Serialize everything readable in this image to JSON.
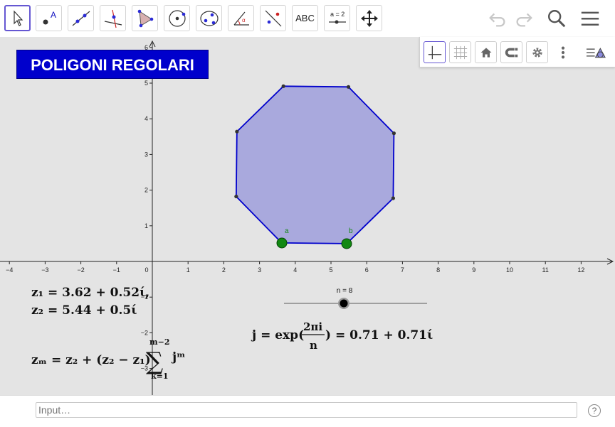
{
  "toolbar": {
    "tools": [
      "move",
      "point",
      "line",
      "perpendicular-line",
      "polygon",
      "circle-with-center",
      "ellipse",
      "angle",
      "reflect",
      "text",
      "slider",
      "move-graphics-view"
    ],
    "text_tool_label": "ABC",
    "slider_tool_label": "a = 2",
    "actions": [
      "undo",
      "redo",
      "search",
      "menu"
    ]
  },
  "style_bar": {
    "buttons": [
      "axes-toggle",
      "grid-toggle",
      "standard-view",
      "point-capturing",
      "graphics-settings",
      "more-options",
      "toggle-style-bar"
    ]
  },
  "title": "POLIGONI  REGOLARI",
  "graph": {
    "x_ticks": [
      "−4",
      "−3",
      "−2",
      "−1",
      "0",
      "1",
      "2",
      "3",
      "4",
      "5",
      "6",
      "7",
      "8",
      "9",
      "10",
      "11",
      "12"
    ],
    "y_ticks": [
      "6",
      "5",
      "4",
      "3",
      "2",
      "1",
      "−1",
      "−2",
      "−3"
    ],
    "polygon_color": "#a9a9dd",
    "polygon_edge_color": "#0000cc",
    "point_a_label": "a",
    "point_b_label": "b",
    "slider_label": "n = 8",
    "slider_value": 8
  },
  "formulas": {
    "z1": "z₁ = 3.62 + 0.52ί,",
    "z2": "z₂ = 5.44 + 0.5ί",
    "j_lhs": "j = exp(",
    "j_num": "2πi",
    "j_den": "n",
    "j_rhs": ") = 0.71 + 0.71ί",
    "zm_lhs": "zₘ = z₂ + (z₂ − z₁)",
    "sum_upper": "m−2",
    "sum_lower": "k=1",
    "sum_symbol": "∑",
    "sum_term": "jᵐ"
  },
  "input_bar": {
    "placeholder": "Input…",
    "help_label": "?"
  }
}
